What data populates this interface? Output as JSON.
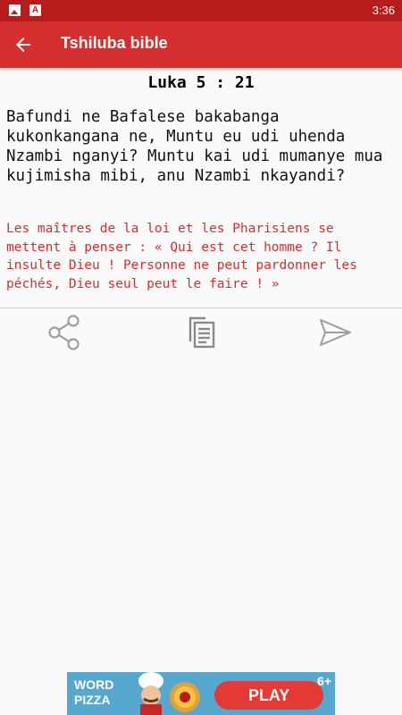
{
  "status_bar": {
    "time": "3:36",
    "icons": [
      "image-notification-icon",
      "font-notification-icon"
    ],
    "font_glyph": "A"
  },
  "app_bar": {
    "title": "Tshiluba bible",
    "back_icon": "arrow-back-icon",
    "color": "#d32f2f"
  },
  "verse": {
    "reference": "Luka 5 : 21",
    "text": "Bafundi ne Bafalese bakabanga kukonkangana ne, Muntu eu udi uhenda Nzambi nganyi? Muntu kai udi mumanye mua kujimisha mibi, anu Nzambi nkayandi?",
    "translation": "Les maîtres de la loi et les Pharisiens se mettent à penser : « Qui est cet homme ? Il insulte Dieu ! Personne ne peut pardonner les péchés, Dieu seul peut le faire ! »",
    "translation_color": "#d32f2f"
  },
  "actions": [
    {
      "icon": "share-icon"
    },
    {
      "icon": "copy-icon"
    },
    {
      "icon": "send-icon"
    }
  ],
  "ad": {
    "brand": "WORD PIZZA",
    "brand_line1": "WORD",
    "brand_line2": "PIZZA",
    "cta": "PLAY",
    "age_rating": "6+"
  }
}
